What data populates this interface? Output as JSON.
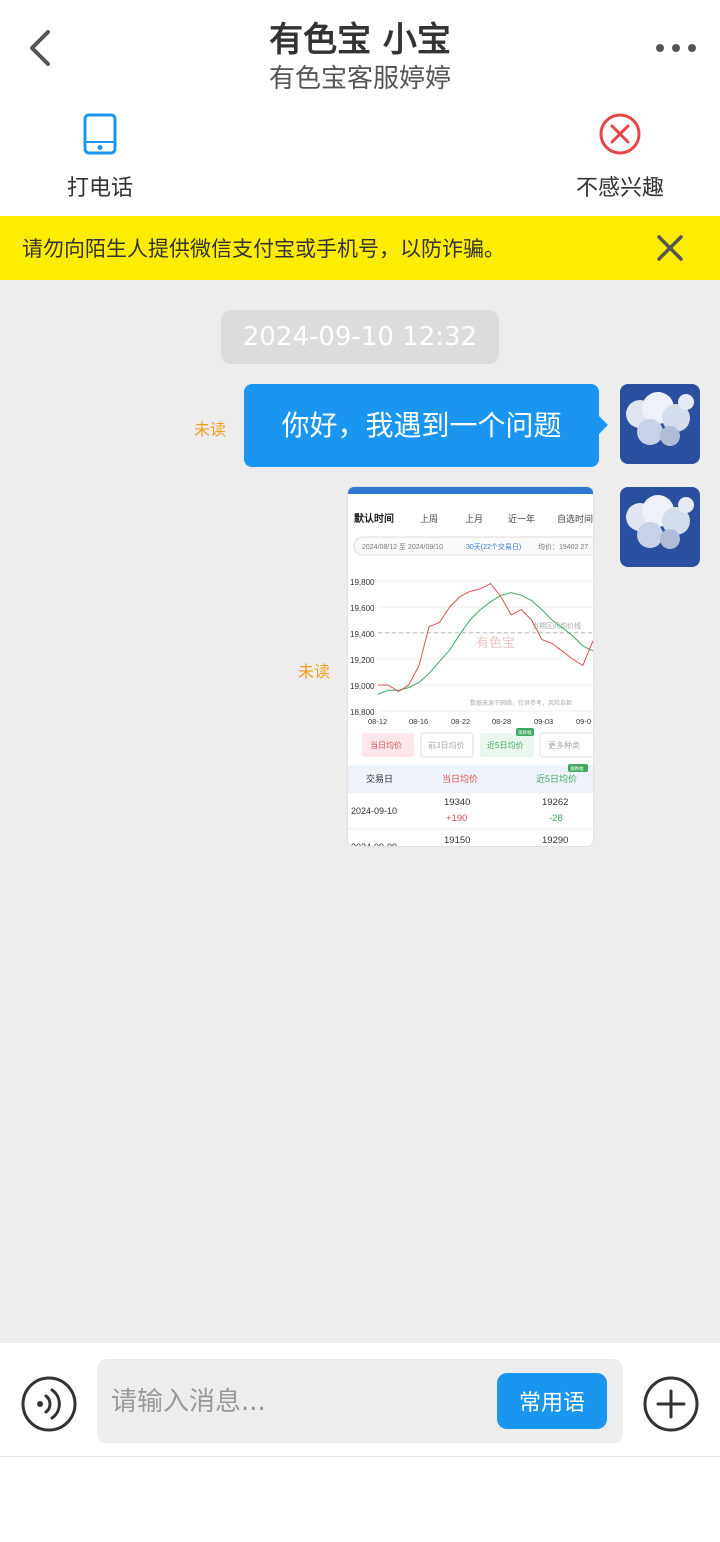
{
  "header": {
    "title": "有色宝 小宝",
    "subtitle": "有色宝客服婷婷",
    "back_icon": "chevron-left-icon",
    "more_icon": "more-dots-icon"
  },
  "actions": {
    "call": {
      "label": "打电话",
      "icon": "phone-icon",
      "color": "#1a96f0"
    },
    "not_interested": {
      "label": "不感兴趣",
      "icon": "close-circle-icon",
      "color": "#e54545"
    }
  },
  "warning": {
    "text": "请勿向陌生人提供微信支付宝或手机号，以防诈骗。",
    "background": "#ffed00"
  },
  "chat": {
    "timestamp": "2024-09-10 12:32",
    "messages": [
      {
        "type": "text",
        "text": "你好，我遇到一个问题",
        "status": "未读"
      },
      {
        "type": "image",
        "status": "未读"
      }
    ]
  },
  "screenshot": {
    "tabs": [
      "默认时间",
      "上周",
      "上月",
      "近一年",
      "自选时间"
    ],
    "range_text": "2024/08/12 至 2024/09/10",
    "range_days": "30天(22个交易日)",
    "avg_text": "均价：19402 27",
    "legend_label": "当期区间均价线",
    "watermark": "有色宝",
    "source_note": "数据来源于网络，仅供参考，风险自担",
    "chart_data": {
      "type": "line",
      "x": [
        "08-12",
        "08-16",
        "08-22",
        "08-28",
        "09-03",
        "09-0"
      ],
      "ylim": [
        18800,
        19800
      ],
      "yticks": [
        "19,800",
        "19,600",
        "19,400",
        "19,200",
        "19,000",
        "18,800"
      ],
      "average": 19402,
      "series": [
        {
          "name": "当日均价",
          "color": "#e05050",
          "values": [
            19000,
            19000,
            18950,
            19000,
            19150,
            19450,
            19480,
            19600,
            19680,
            19720,
            19740,
            19780,
            19680,
            19540,
            19580,
            19500,
            19350,
            19320,
            19260,
            19200,
            19150,
            19340
          ]
        },
        {
          "name": "近5日均价",
          "color": "#3fa860",
          "values": [
            18930,
            18960,
            18960,
            18980,
            19020,
            19090,
            19180,
            19270,
            19390,
            19500,
            19580,
            19640,
            19690,
            19710,
            19690,
            19650,
            19580,
            19500,
            19440,
            19380,
            19300,
            19262
          ]
        }
      ]
    },
    "price_tabs": [
      "当日均价",
      "前3日均价",
      "近5日均价",
      "更多种类"
    ],
    "badge": "涨跌幅",
    "table": {
      "headers": [
        "交易日",
        "当日均价",
        "近5日均价"
      ],
      "rows": [
        {
          "date": "2024-09-10",
          "price": "19340",
          "change": "+190",
          "avg5": "19262",
          "avg5_change": "-28"
        },
        {
          "date": "2024-09-09",
          "price": "19150",
          "avg5": "19290"
        }
      ]
    }
  },
  "input": {
    "placeholder": "请输入消息...",
    "phrases_label": "常用语",
    "voice_icon": "voice-icon",
    "plus_icon": "plus-circle-icon"
  }
}
